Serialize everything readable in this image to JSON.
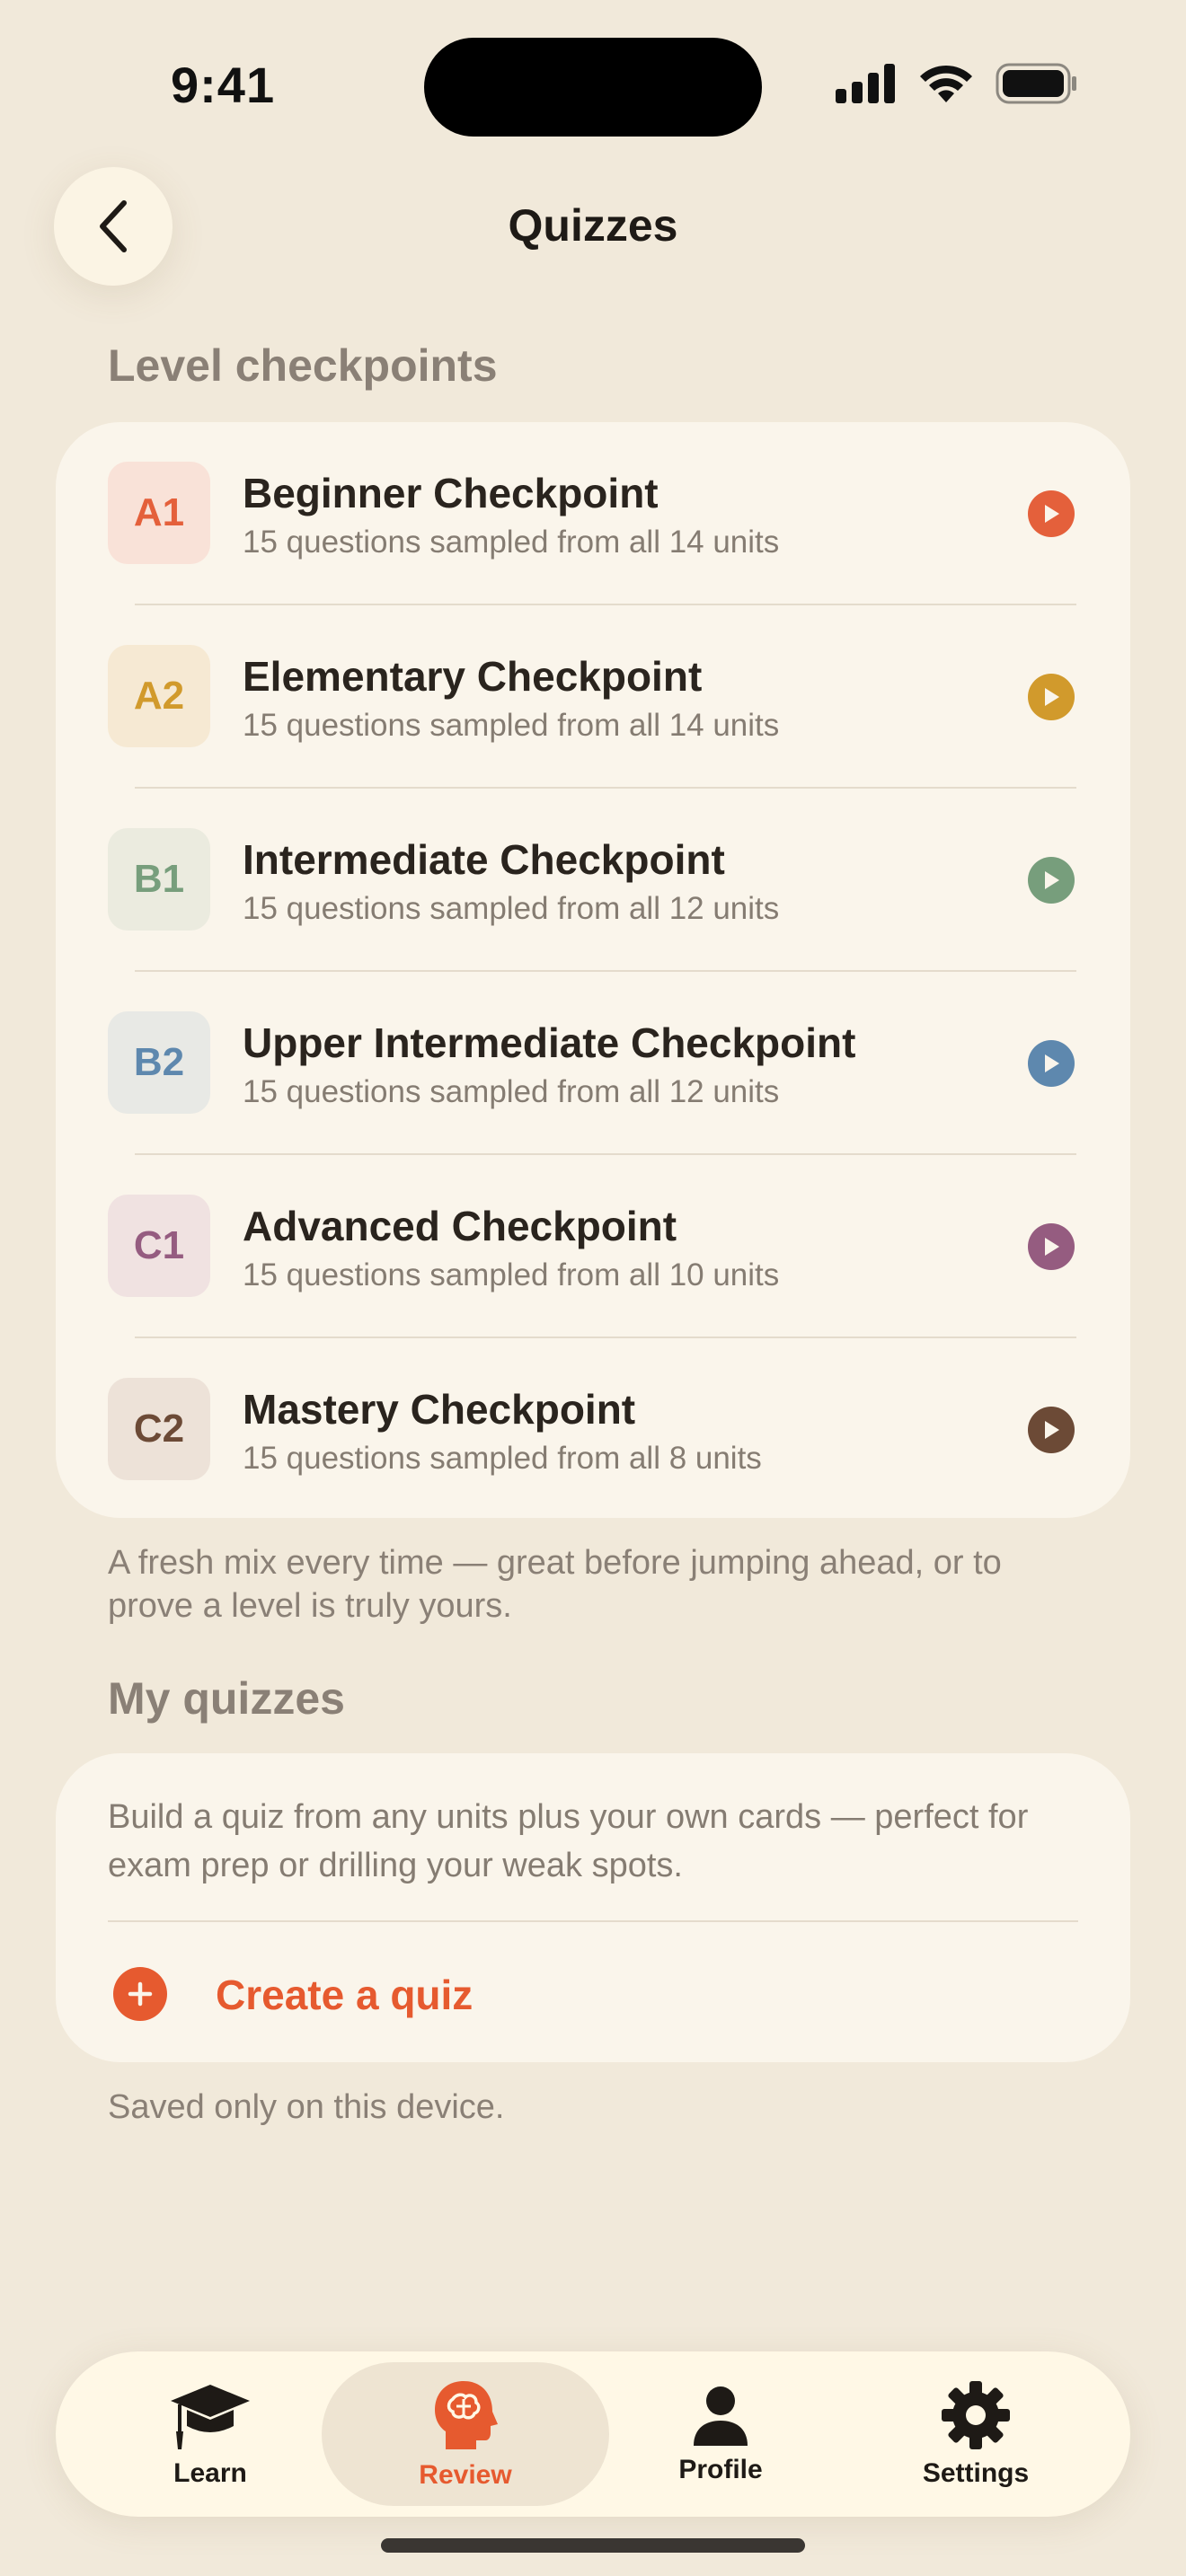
{
  "status": {
    "time": "9:41"
  },
  "nav": {
    "title": "Quizzes"
  },
  "checkpoints": {
    "header": "Level checkpoints",
    "items": [
      {
        "code": "A1",
        "title": "Beginner Checkpoint",
        "subtitle": "15 questions sampled from all 14 units",
        "color": "#E4603B",
        "badge_bg": "#F9E2D8"
      },
      {
        "code": "A2",
        "title": "Elementary Checkpoint",
        "subtitle": "15 questions sampled from all 14 units",
        "color": "#D19A2C",
        "badge_bg": "#F6E9D3"
      },
      {
        "code": "B1",
        "title": "Intermediate Checkpoint",
        "subtitle": "15 questions sampled from all 12 units",
        "color": "#779E7C",
        "badge_bg": "#EBEBDF"
      },
      {
        "code": "B2",
        "title": "Upper Intermediate Checkpoint",
        "subtitle": "15 questions sampled from all 12 units",
        "color": "#5E88AE",
        "badge_bg": "#E8E9E5"
      },
      {
        "code": "C1",
        "title": "Advanced Checkpoint",
        "subtitle": "15 questions sampled from all 10 units",
        "color": "#955C80",
        "badge_bg": "#F0E2E1"
      },
      {
        "code": "C2",
        "title": "Mastery Checkpoint",
        "subtitle": "15 questions sampled from all 8 units",
        "color": "#6C4A36",
        "badge_bg": "#EDE2D8"
      }
    ],
    "footnote": "A fresh mix every time — great before jumping ahead, or to prove a level is truly yours."
  },
  "my_quizzes": {
    "header": "My quizzes",
    "description": "Build a quiz from any units plus your own cards — perfect for exam prep or drilling your weak spots.",
    "create_label": "Create a quiz",
    "footnote": "Saved only on this device."
  },
  "tabbar": {
    "tabs": [
      {
        "label": "Learn",
        "icon": "graduation-cap-icon",
        "active": false
      },
      {
        "label": "Review",
        "icon": "brain-head-icon",
        "active": true
      },
      {
        "label": "Profile",
        "icon": "person-icon",
        "active": false
      },
      {
        "label": "Settings",
        "icon": "gear-icon",
        "active": false
      }
    ]
  },
  "colors": {
    "accent": "#E65A2F",
    "background": "#F1E9DA",
    "card": "#FAF5EB"
  }
}
